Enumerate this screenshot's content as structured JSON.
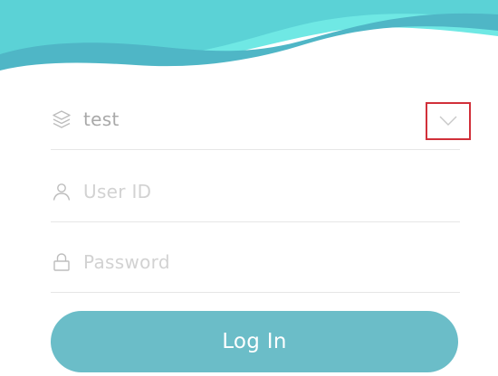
{
  "header": {
    "wave_icon": "decorative-wave",
    "colors": [
      "#6fe8e4",
      "#5bd2d6",
      "#4fb6c6"
    ]
  },
  "form": {
    "database": {
      "icon": "layers-icon",
      "value": "test",
      "dropdown_icon": "chevron-down-icon"
    },
    "user_id": {
      "icon": "user-icon",
      "placeholder": "User ID"
    },
    "password": {
      "icon": "lock-icon",
      "placeholder": "Password"
    },
    "login_label": "Log In"
  },
  "colors": {
    "accent": "#6bbdc8",
    "highlight_border": "#d1303a"
  }
}
